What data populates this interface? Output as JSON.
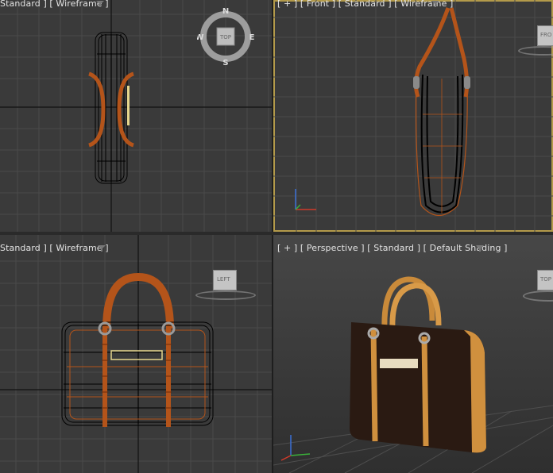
{
  "viewports": {
    "top": {
      "label": "Standard ] [ Wireframe ]",
      "viewcube": {
        "face": "TOP",
        "n": "N",
        "s": "S",
        "e": "E",
        "w": "W"
      }
    },
    "front": {
      "label": "[ + ] [ Front ] [ Standard ] [ Wireframe ]",
      "viewcube": {
        "face": "FRO"
      }
    },
    "left": {
      "label": "Standard ] [ Wireframe ]",
      "viewcube": {
        "face": "LEFT"
      }
    },
    "perspective": {
      "label": "[ + ] [ Perspective ] [ Standard ] [ Default Shading ]",
      "viewcube": {
        "face": "TOP"
      }
    }
  },
  "colors": {
    "grid_line": "#4a4a4a",
    "axis_line": "#111111",
    "handle_wire": "#b4541a",
    "body_wire": "#000000",
    "bag_leather": "#2a1a12",
    "bag_trim": "#d0903e",
    "label_strip": "#e8dcc0",
    "active_border": "#b39a4a"
  }
}
